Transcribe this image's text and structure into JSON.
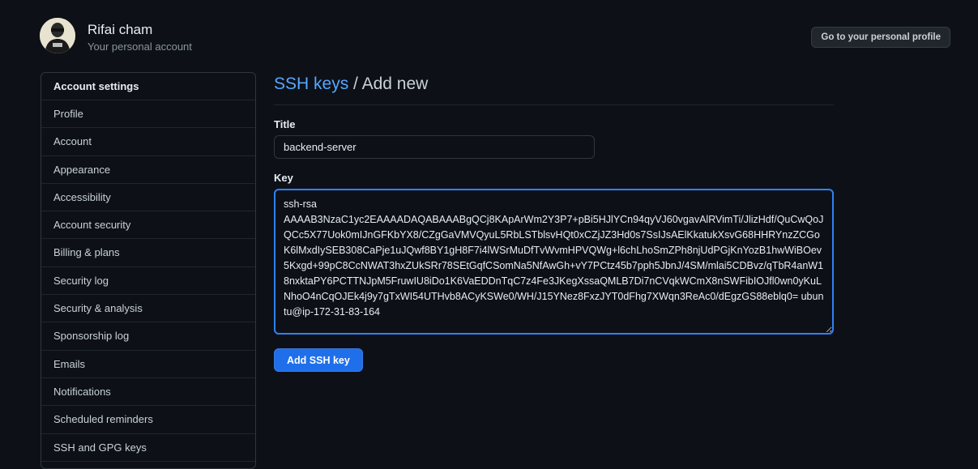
{
  "header": {
    "user_name": "Rifai cham",
    "user_subtitle": "Your personal account",
    "profile_button": "Go to your personal profile"
  },
  "sidebar": {
    "heading": "Account settings",
    "items": [
      {
        "label": "Profile"
      },
      {
        "label": "Account"
      },
      {
        "label": "Appearance"
      },
      {
        "label": "Accessibility"
      },
      {
        "label": "Account security"
      },
      {
        "label": "Billing & plans"
      },
      {
        "label": "Security log"
      },
      {
        "label": "Security & analysis"
      },
      {
        "label": "Sponsorship log"
      },
      {
        "label": "Emails"
      },
      {
        "label": "Notifications"
      },
      {
        "label": "Scheduled reminders"
      },
      {
        "label": "SSH and GPG keys"
      }
    ]
  },
  "main": {
    "breadcrumb_link": "SSH keys",
    "breadcrumb_sep": " / ",
    "breadcrumb_current": "Add new",
    "title_label": "Title",
    "title_value": "backend-server",
    "key_label": "Key",
    "key_value": "ssh-rsa\nAAAAB3NzaC1yc2EAAAADAQABAAABgQCj8KApArWm2Y3P7+pBi5HJlYCn94qyVJ60vgavAlRVimTi/JlizHdf/QuCwQoJQCc5X77Uok0mIJnGFKbYX8/CZgGaVMVQyuL5RbLSTblsvHQt0xCZjJZ3Hd0s7SsIJsAElKkatukXsvG68HHRYnzZCGoK6lMxdIySEB308CaPje1uJQwf8BY1gH8F7i4lWSrMuDfTvWvmHPVQWg+l6chLhoSmZPh8njUdPGjKnYozB1hwWiBOev5Kxgd+99pC8CcNWAT3hxZUkSRr78SEtGqfCSomNa5NfAwGh+vY7PCtz45b7pph5JbnJ/4SM/mlai5CDBvz/qTbR4anW18nxktaPY6PCTTNJpM5FruwIU8iDo1K6VaEDDnTqC7z4Fe3JKegXssaQMLB7Di7nCVqkWCmX8nSWFibIOJfl0wn0yKuLNhoO4nCqOJEk4j9y7gTxWI54UTHvb8ACyKSWe0/WH/J15YNez8FxzJYT0dFhg7XWqn3ReAc0/dEgzGS88eblq0= ubuntu@ip-172-31-83-164",
    "submit_label": "Add SSH key"
  },
  "colors": {
    "background": "#0d1117",
    "link": "#58a6ff",
    "primary_button": "#1f6feb",
    "focus_border": "#2f81f7"
  }
}
